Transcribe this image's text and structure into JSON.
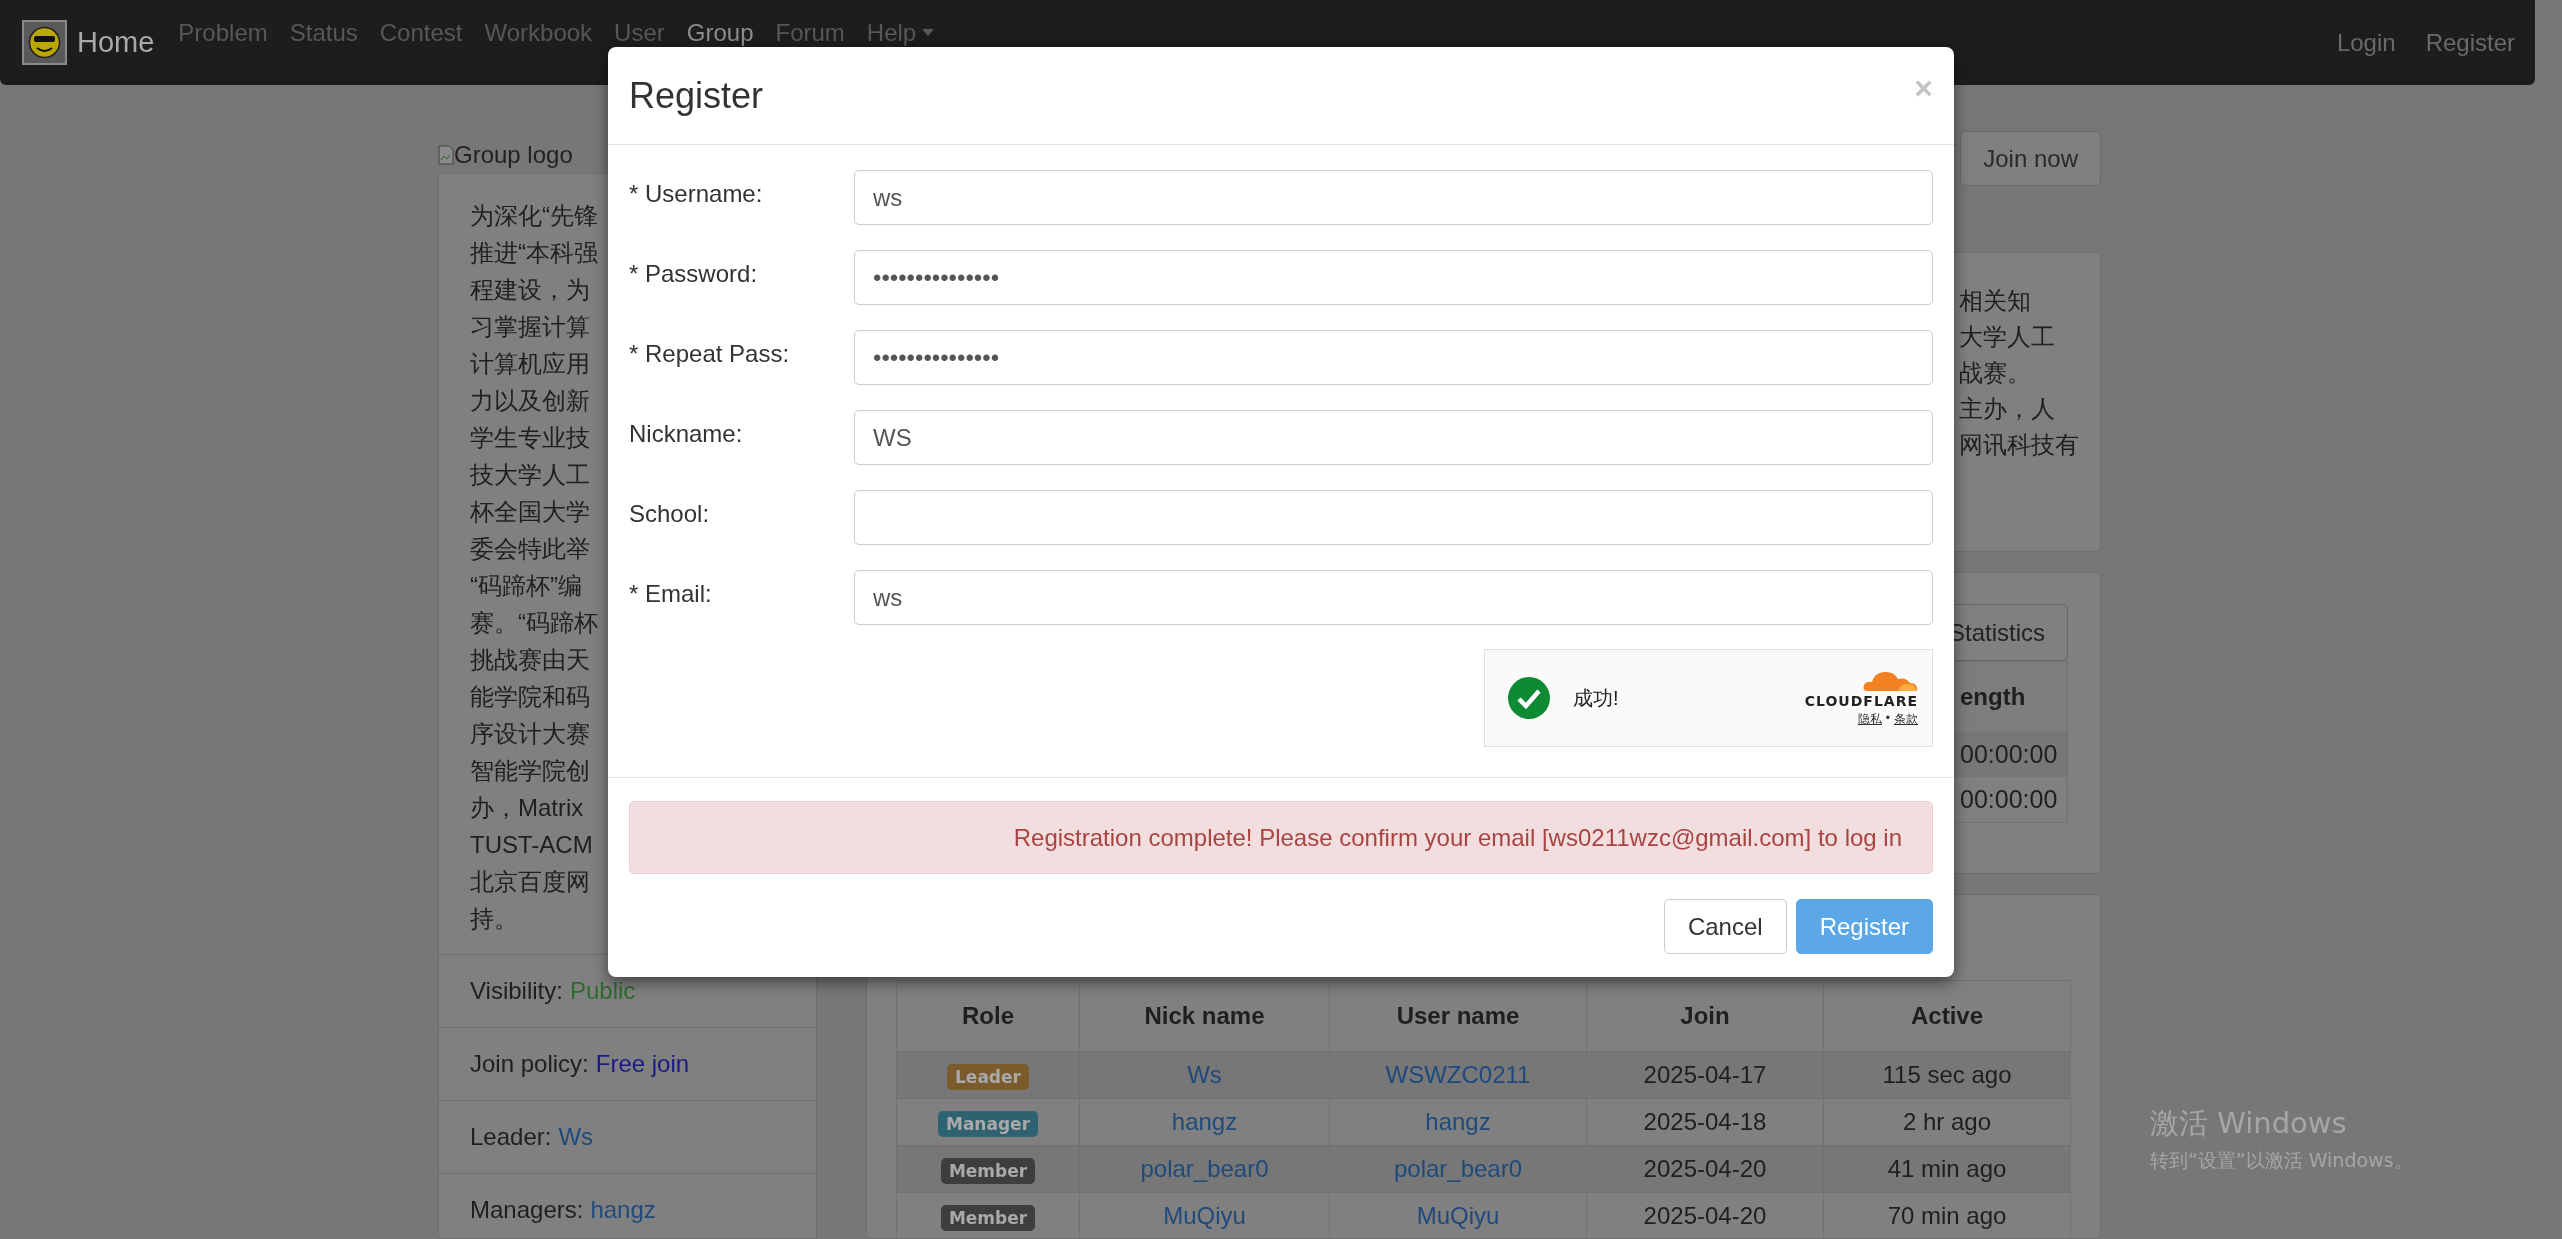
{
  "navbar": {
    "brand": "Home",
    "items": [
      {
        "label": "Problem",
        "selected": false
      },
      {
        "label": "Status",
        "selected": false
      },
      {
        "label": "Contest",
        "selected": false
      },
      {
        "label": "Workbook",
        "selected": false
      },
      {
        "label": "User",
        "selected": false
      },
      {
        "label": "Group",
        "selected": true
      },
      {
        "label": "Forum",
        "selected": false
      },
      {
        "label": "Help",
        "selected": false,
        "dropdown": true
      }
    ],
    "right": [
      "Login",
      "Register"
    ]
  },
  "sidebar": {
    "logo_alt": "Group logo",
    "description_lines": [
      "为深化“先锋",
      "推进“本科强",
      "程建设，为",
      "习掌握计算",
      "计算机应用",
      "力以及创新",
      "学生专业技",
      "技大学人工",
      "杯全国大学",
      "委会特此举",
      "“码蹄杯”编",
      "赛。“码蹄杯",
      "挑战赛由天",
      "能学院和码",
      "序设计大赛",
      "智能学院创",
      "办，Matrix",
      "TUST-ACM",
      "北京百度网",
      "持。"
    ],
    "info": [
      {
        "label": "Visibility:",
        "value": "Public",
        "kind": "status"
      },
      {
        "label": "Join policy:",
        "value": "Free join",
        "kind": "policy"
      },
      {
        "label": "Leader:",
        "value": "Ws",
        "kind": "user"
      },
      {
        "label": "Managers:",
        "value": "hangz",
        "kind": "user"
      }
    ]
  },
  "join_button": "Join now",
  "description_panel": {
    "lines": [
      "相关知",
      "大学人工",
      "战赛。",
      "主办，人",
      "网讯科技有"
    ]
  },
  "contests_panel": {
    "button": "Statistics",
    "column": "ength",
    "rows": [
      "00:00:00",
      "00:00:00"
    ]
  },
  "members_table": {
    "columns": [
      "Role",
      "Nick name",
      "User name",
      "Join",
      "Active"
    ],
    "rows": [
      {
        "role": "Leader",
        "color": "#7b5a2b",
        "nick": "Ws",
        "username": "WSWZC0211",
        "join": "2025-04-17",
        "active": "115 sec ago"
      },
      {
        "role": "Manager",
        "color": "#2e6270",
        "nick": "hangz",
        "username": "hangz",
        "join": "2025-04-18",
        "active": "2 hr ago"
      },
      {
        "role": "Member",
        "color": "#3e3e3e",
        "nick": "polar_bear0",
        "username": "polar_bear0",
        "join": "2025-04-20",
        "active": "41 min ago"
      },
      {
        "role": "Member",
        "color": "#3e3e3e",
        "nick": "MuQiyu",
        "username": "MuQiyu",
        "join": "2025-04-20",
        "active": "70 min ago"
      }
    ]
  },
  "modal": {
    "title": "Register",
    "close": "×",
    "fields": [
      {
        "label": "* Username:",
        "value": "ws"
      },
      {
        "label": "* Password:",
        "value": "•••••••••••••••"
      },
      {
        "label": "* Repeat Pass:",
        "value": "•••••••••••••••"
      },
      {
        "label": "Nickname:",
        "value": "WS"
      },
      {
        "label": "School:"
      },
      {
        "label": "* Email:",
        "value": "ws"
      }
    ],
    "captcha": {
      "status": "成功!",
      "brand": "CLOUDFLARE",
      "links": [
        "隐私",
        "条款"
      ],
      "separator": "•"
    },
    "alert": "Registration complete! Please confirm your email [ws0211wzc@gmail.com] to log in",
    "buttons": [
      {
        "label": "Cancel",
        "kind": "default"
      },
      {
        "label": "Register",
        "kind": "primary"
      }
    ]
  },
  "os_notice": {
    "title": "激活 Windows",
    "subtitle": "转到“设置”以激活 Windows。"
  }
}
